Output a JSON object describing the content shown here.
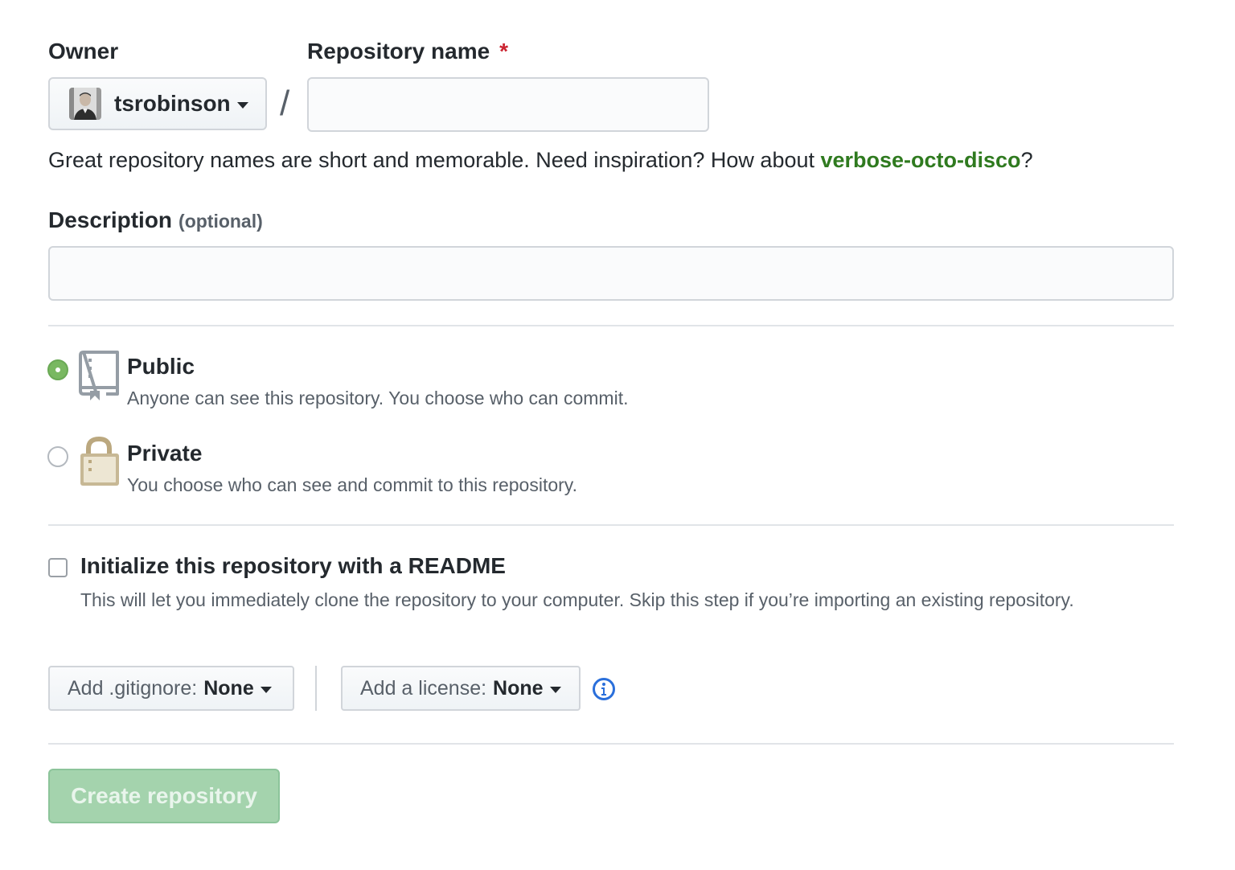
{
  "owner": {
    "label": "Owner",
    "username": "tsrobinson"
  },
  "repo_name": {
    "label": "Repository name",
    "required_marker": "*",
    "value": "",
    "separator": "/"
  },
  "hint": {
    "text_before": "Great repository names are short and memorable. Need inspiration? How about ",
    "suggestion": "verbose-octo-disco",
    "text_after": "?"
  },
  "description": {
    "label": "Description",
    "optional": "(optional)",
    "value": ""
  },
  "visibility": {
    "selected": "public",
    "public": {
      "title": "Public",
      "desc": "Anyone can see this repository. You choose who can commit.",
      "icon": "repo-book-icon"
    },
    "private": {
      "title": "Private",
      "desc": "You choose who can see and commit to this repository.",
      "icon": "lock-icon"
    }
  },
  "readme": {
    "checked": false,
    "title": "Initialize this repository with a README",
    "desc": "This will let you immediately clone the repository to your computer. Skip this step if you’re importing an existing repository."
  },
  "gitignore": {
    "prefix": "Add .gitignore:",
    "value": "None"
  },
  "license": {
    "prefix": "Add a license:",
    "value": "None"
  },
  "create_button": {
    "label": "Create repository",
    "disabled": true
  },
  "colors": {
    "link_green": "#2f7a1f",
    "required_red": "#cb2431",
    "radio_green": "#79b861",
    "button_disabled_green": "#a4d3ad",
    "info_blue": "#2a6fdb"
  }
}
